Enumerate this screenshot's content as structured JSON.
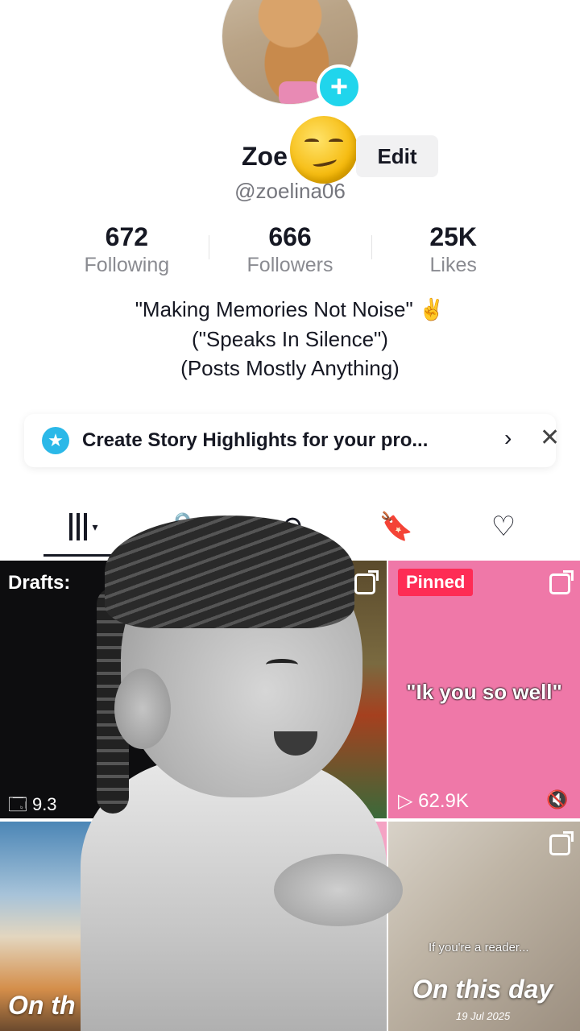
{
  "profile": {
    "name": "Zoe",
    "edit_label": "Edit",
    "handle": "@zoelina06"
  },
  "stats": [
    {
      "value": "672",
      "label": "Following"
    },
    {
      "value": "666",
      "label": "Followers"
    },
    {
      "value": "25K",
      "label": "Likes"
    }
  ],
  "bio": {
    "line1": "\"Making Memories Not Noise\" ✌️",
    "line2": "(\"Speaks In Silence\")",
    "line3": "(Posts Mostly Anything)"
  },
  "banner": {
    "icon": "star-icon",
    "text": "Create Story Highlights for your pro...",
    "chevron": "›",
    "close": "✕"
  },
  "tabs": {
    "videos_caret": "▾",
    "lock": "🔒",
    "repost": "⟲",
    "saved": "🔖",
    "liked": "♡"
  },
  "grid": {
    "drafts_label": "Drafts: ",
    "drafts_count": "🗔 9.3",
    "pinned_badge": "Pinned",
    "pinned_caption": "\"Ik you so well\"",
    "pinned_views": "▷ 62.9K",
    "pinned_mute": "🔇",
    "sky_caption": "On th",
    "books_caption": "If you're a reader...",
    "books_title": "On this day",
    "books_date": "19 Jul 2025"
  },
  "colors": {
    "accent": "#fe2c55",
    "plus_badge": "#20d5ec",
    "pinned_bg": "#ef78a8"
  }
}
